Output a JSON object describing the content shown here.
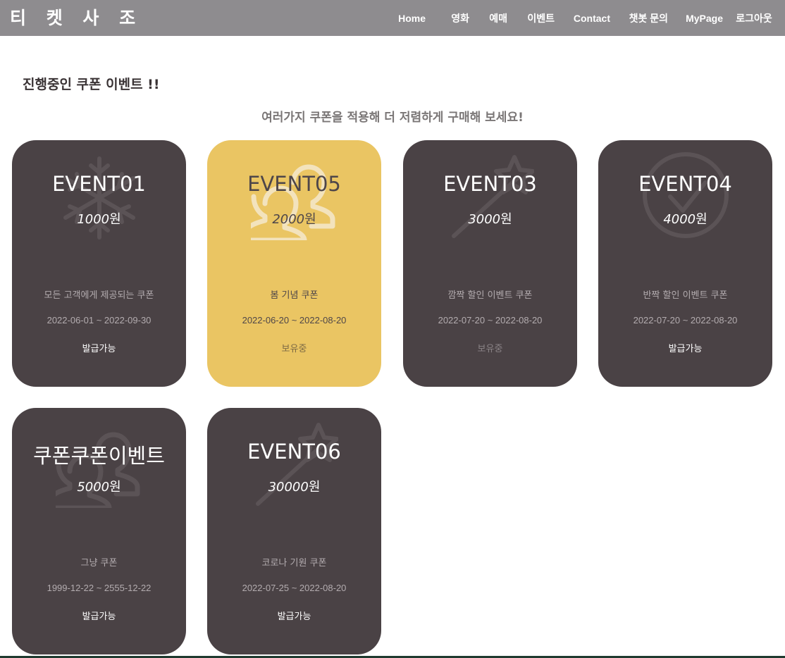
{
  "nav": {
    "brand": "티 켓 사 조",
    "items": [
      "Home",
      "영화",
      "예매",
      "이벤트",
      "Contact",
      "챗봇 문의",
      "MyPage",
      "로그아웃"
    ]
  },
  "section": {
    "title": "진행중인 쿠폰 이벤트 !!",
    "subtitle": "여러가지 쿠폰을 적용해 더 저렴하게 구매해 보세요!"
  },
  "cards": [
    {
      "title": "EVENT01",
      "price": "1000",
      "unit": "원",
      "desc": "모든 고객에게 제공되는 쿠폰",
      "period": "2022-06-01 ~ 2022-09-30",
      "status": "발급가능",
      "icon": "snowflake-icon"
    },
    {
      "title": "EVENT05",
      "price": "2000",
      "unit": "원",
      "desc": "봄 기념 쿠폰",
      "period": "2022-06-20 ~ 2022-08-20",
      "status": "보유중",
      "icon": "users-icon"
    },
    {
      "title": "EVENT03",
      "price": "3000",
      "unit": "원",
      "desc": "깜짝 할인 이벤트 쿠폰",
      "period": "2022-07-20 ~ 2022-08-20",
      "status": "보유중",
      "icon": "magic-wand-icon"
    },
    {
      "title": "EVENT04",
      "price": "4000",
      "unit": "원",
      "desc": "반짝 할인 이벤트 쿠폰",
      "period": "2022-07-20 ~ 2022-08-20",
      "status": "발급가능",
      "icon": "circle-check-icon"
    },
    {
      "title": "쿠폰쿠폰이벤트",
      "price": "5000",
      "unit": "원",
      "desc": "그냥 쿠폰",
      "period": "1999-12-22 ~ 2555-12-22",
      "status": "발급가능",
      "icon": "users-icon"
    },
    {
      "title": "EVENT06",
      "price": "30000",
      "unit": "원",
      "desc": "코로나 기원 쿠폰",
      "period": "2022-07-25 ~ 2022-08-20",
      "status": "발급가능",
      "icon": "magic-wand-icon"
    }
  ],
  "colors": {
    "navbar": "#8e8c8f",
    "card": "#4a4245",
    "card_highlight": "#eac563"
  }
}
